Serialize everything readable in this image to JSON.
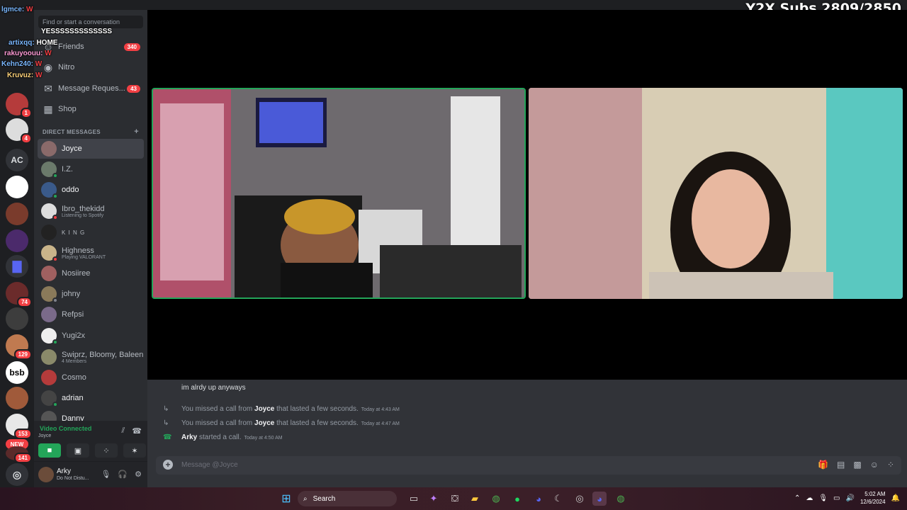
{
  "stream": {
    "subs_goal": "Y2X Subs 2809/2850"
  },
  "chat_overlay": [
    {
      "name": "lgmce:",
      "msg": "W"
    },
    {
      "name": "",
      "msg": "YESSSSSSSSSSSSS"
    },
    {
      "name": "artixqq:",
      "msg": "HOME"
    },
    {
      "name": "rakuyoouu:",
      "msg": "W"
    },
    {
      "name": "Kehn240:",
      "msg": "W"
    },
    {
      "name": "Kruvuz:",
      "msg": "W"
    }
  ],
  "rail": {
    "servers": [
      {
        "label": "",
        "badge": "1"
      },
      {
        "label": "",
        "badge": "4"
      },
      {
        "label": "AC",
        "badge": ""
      },
      {
        "label": "",
        "badge": ""
      },
      {
        "label": "",
        "badge": ""
      },
      {
        "label": "",
        "badge": ""
      },
      {
        "label": "",
        "badge": ""
      },
      {
        "label": "",
        "badge": "74"
      },
      {
        "label": "",
        "badge": ""
      },
      {
        "label": "",
        "badge": "129"
      },
      {
        "label": "bsb",
        "badge": ""
      },
      {
        "label": "",
        "badge": ""
      },
      {
        "label": "",
        "badge": "153"
      },
      {
        "label": "",
        "badge": "141"
      }
    ],
    "new_label": "NEW"
  },
  "sidebar": {
    "search_placeholder": "Find or start a conversation",
    "nav": [
      {
        "label": "Friends",
        "badge": "340"
      },
      {
        "label": "Nitro",
        "badge": ""
      },
      {
        "label": "Message Reques...",
        "badge": "43"
      },
      {
        "label": "Shop",
        "badge": ""
      }
    ],
    "dm_header": "DIRECT MESSAGES",
    "dms": [
      {
        "name": "Joyce",
        "sub": ""
      },
      {
        "name": "I.Z.",
        "sub": ""
      },
      {
        "name": "oddo",
        "sub": ""
      },
      {
        "name": "Ibro_thekidd",
        "sub": "Listening to Spotify"
      },
      {
        "name": "K I N G",
        "sub": ""
      },
      {
        "name": "Highness",
        "sub": "Playing VALORANT"
      },
      {
        "name": "Nosiiree",
        "sub": ""
      },
      {
        "name": "johny",
        "sub": ""
      },
      {
        "name": "Refpsi",
        "sub": ""
      },
      {
        "name": "Yugi2x",
        "sub": ""
      },
      {
        "name": "Swiprz, Bloomy, Baleen",
        "sub": "4 Members"
      },
      {
        "name": "Cosmo",
        "sub": ""
      },
      {
        "name": "adrian",
        "sub": ""
      },
      {
        "name": "Danny",
        "sub": ""
      }
    ]
  },
  "voice": {
    "status": "Video Connected",
    "channel": "Joyce"
  },
  "user": {
    "name": "Arky",
    "status": "Do Not Distu..."
  },
  "chat": {
    "message": "im alrdy up anyways",
    "events": [
      {
        "pre": "You missed a call from ",
        "who": "Joyce",
        "post": " that lasted a few seconds.",
        "time": "Today at 4:43 AM"
      },
      {
        "pre": "You missed a call from ",
        "who": "Joyce",
        "post": " that lasted a few seconds.",
        "time": "Today at 4:47 AM"
      },
      {
        "pre": "",
        "who": "Arky",
        "post": " started a call.",
        "time": "Today at 4:50 AM"
      }
    ],
    "composer_placeholder": "Message @Joyce"
  },
  "taskbar": {
    "search": "Search",
    "time": "5:02 AM",
    "date": "12/6/2024"
  },
  "colors": {
    "online": "#23a559",
    "dnd": "#f23f43",
    "accent": "#5865f2"
  }
}
